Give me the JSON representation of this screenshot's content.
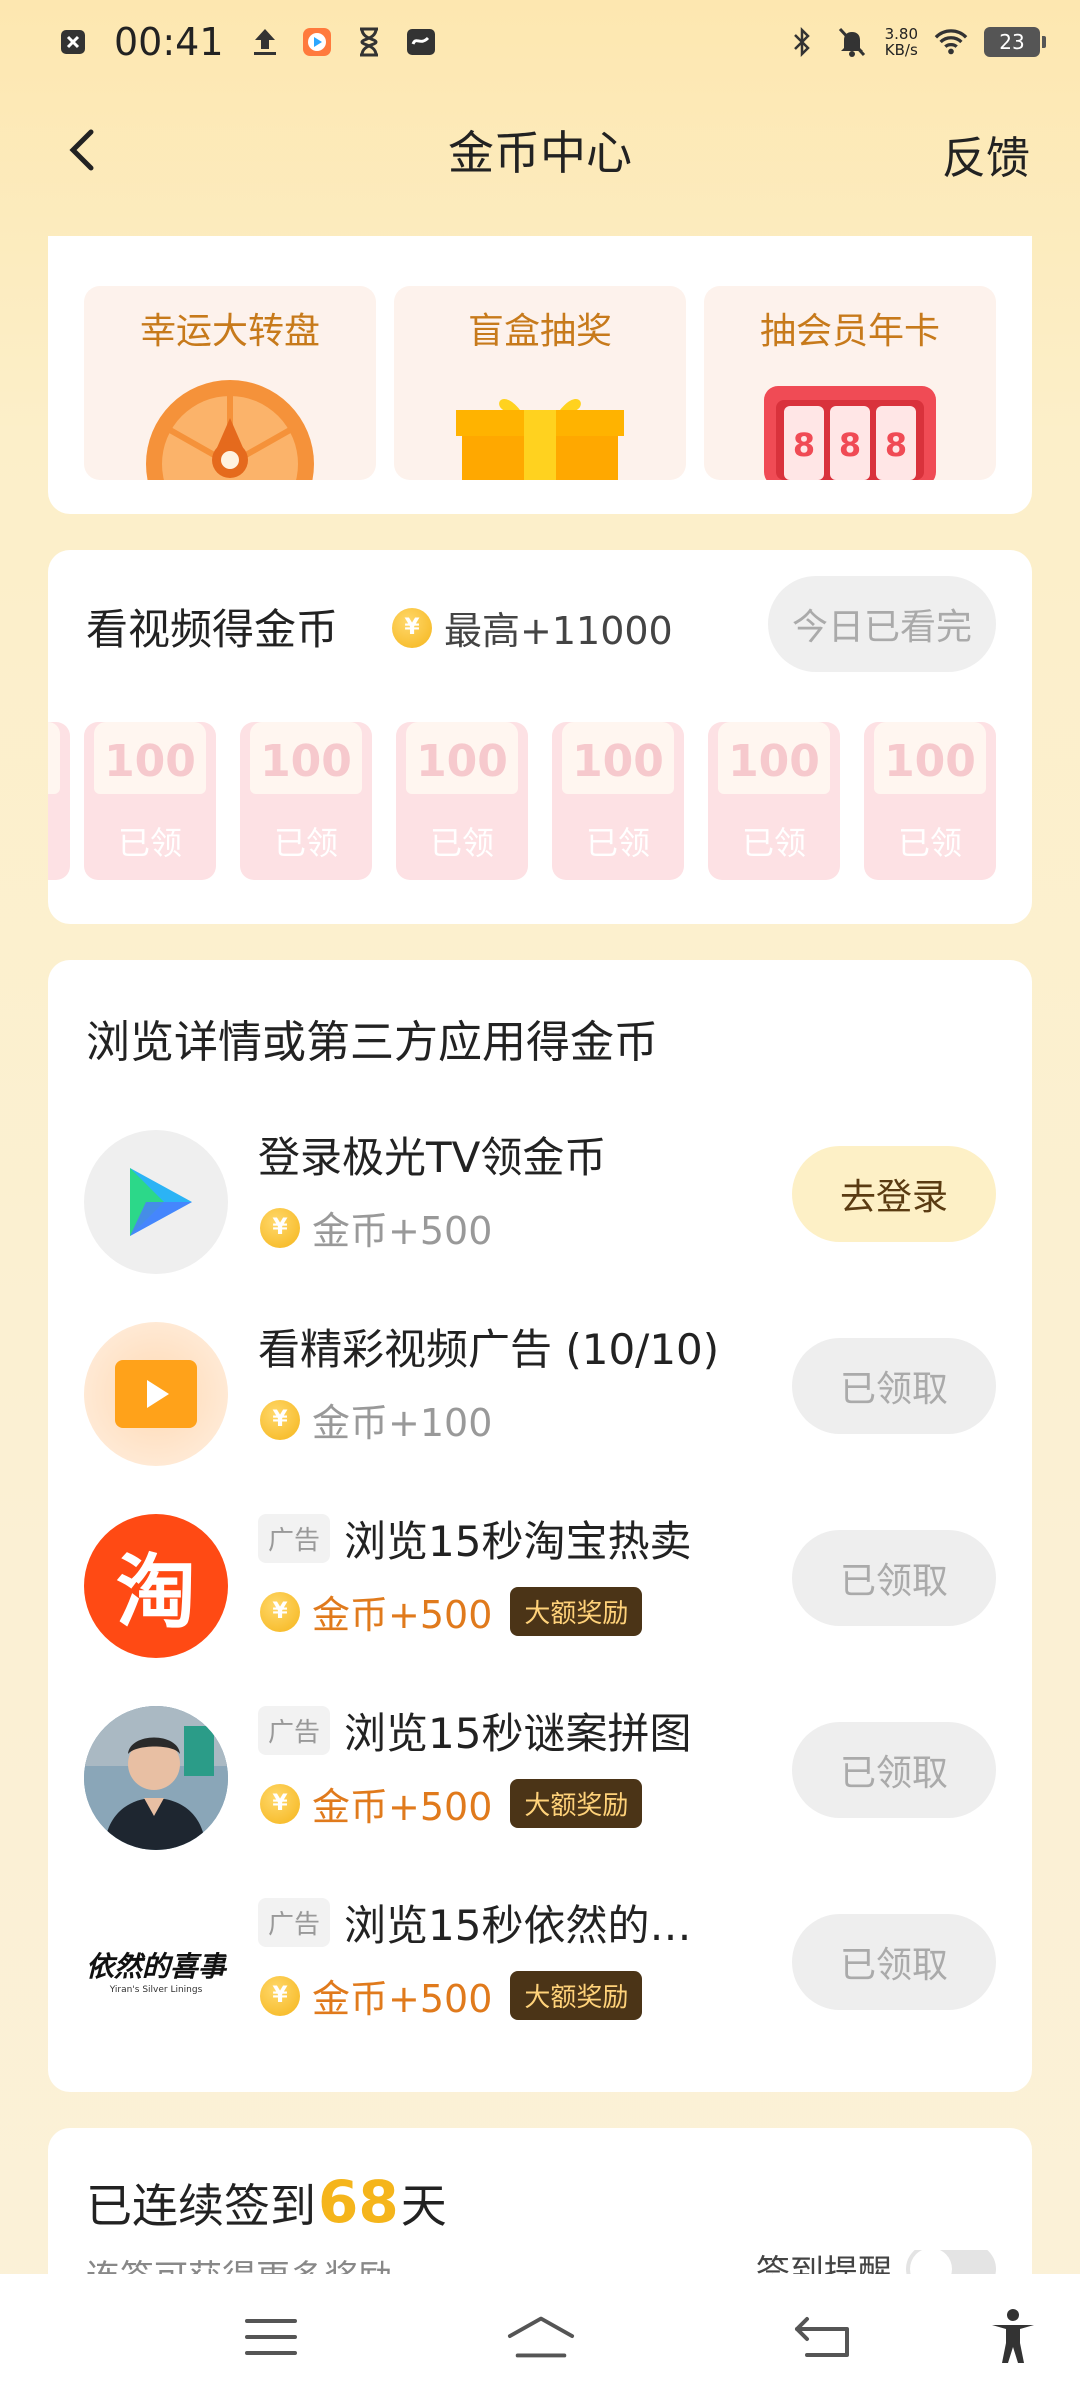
{
  "status_bar": {
    "time": "00:41",
    "net_speed_value": "3.80",
    "net_speed_unit": "KB/s",
    "battery": "23"
  },
  "header": {
    "title": "金币中心",
    "feedback_label": "反馈"
  },
  "games": [
    {
      "title": "幸运大转盘"
    },
    {
      "title": "盲盒抽奖"
    },
    {
      "title": "抽会员年卡",
      "digits": [
        "8",
        "8",
        "8"
      ]
    }
  ],
  "video_section": {
    "title": "看视频得金币",
    "max_reward": "最高+11000",
    "status_button": "今日已看完",
    "envelopes": [
      {
        "amount": "100",
        "label": "已领"
      },
      {
        "amount": "100",
        "label": "已领"
      },
      {
        "amount": "100",
        "label": "已领"
      },
      {
        "amount": "100",
        "label": "已领"
      },
      {
        "amount": "100",
        "label": "已领"
      },
      {
        "amount": "100",
        "label": "已领"
      }
    ]
  },
  "tasks_section": {
    "title": "浏览详情或第三方应用得金币",
    "coin_symbol": "¥",
    "ad_tag": "广告",
    "big_badge": "大额奖励",
    "items": [
      {
        "name": "登录极光TV领金币",
        "reward": "金币+500",
        "button": "去登录"
      },
      {
        "name": "看精彩视频广告 (10/10)",
        "reward": "金币+100",
        "button": "已领取"
      },
      {
        "name": "浏览15秒淘宝热卖",
        "reward": "金币+500",
        "button": "已领取",
        "icon_text": "淘"
      },
      {
        "name": "浏览15秒谜案拼图",
        "reward": "金币+500",
        "button": "已领取"
      },
      {
        "name": "浏览15秒依然的…",
        "reward": "金币+500",
        "button": "已领取",
        "icon_text": "依然的喜事",
        "icon_subtext": "Yiran's Silver Linings"
      }
    ]
  },
  "sign_in": {
    "prefix": "已连续签到",
    "days": "68",
    "suffix": "天",
    "subtitle": "连签可获得更多奖励",
    "remind_label": "签到提醒"
  },
  "colors": {
    "accent_gold": "#f5b51b",
    "reward_orange": "#e07a1c",
    "badge_dark": "#4b3417"
  }
}
